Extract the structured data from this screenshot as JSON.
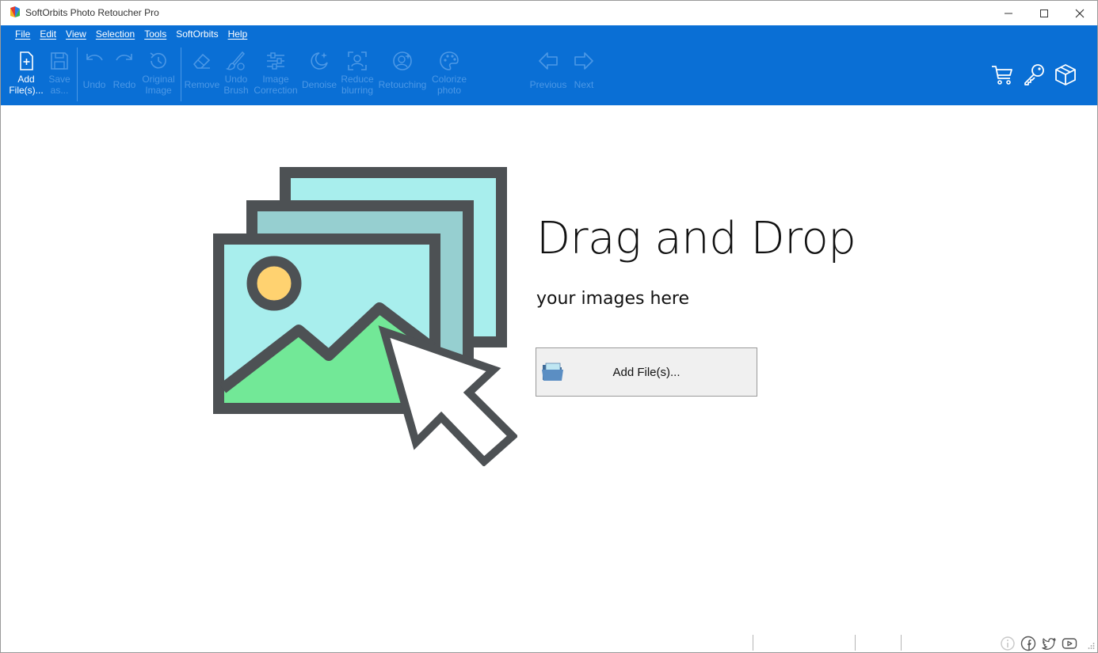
{
  "window": {
    "title": "SoftOrbits Photo Retoucher Pro",
    "controls": [
      "minimize",
      "maximize",
      "close"
    ]
  },
  "menu": [
    {
      "label": "File"
    },
    {
      "label": "Edit"
    },
    {
      "label": "View"
    },
    {
      "label": "Selection"
    },
    {
      "label": "Tools"
    },
    {
      "label": "SoftOrbits"
    },
    {
      "label": "Help"
    }
  ],
  "toolbar": {
    "add_files": "Add\nFile(s)...",
    "save_as": "Save\nas...",
    "undo": "Undo",
    "redo": "Redo",
    "original_image": "Original\nImage",
    "remove": "Remove",
    "undo_brush": "Undo\nBrush",
    "image_correction": "Image\nCorrection",
    "denoise": "Denoise",
    "reduce_blurring": "Reduce\nblurring",
    "retouching": "Retouching",
    "colorize_photo": "Colorize\nphoto",
    "previous": "Previous",
    "next": "Next"
  },
  "right_icons": [
    "cart-icon",
    "key-icon",
    "box-icon"
  ],
  "main": {
    "headline": "Drag and Drop",
    "subline": "your images here",
    "add_button_label": "Add File(s)..."
  },
  "status_icons": [
    "info-icon",
    "facebook-icon",
    "twitter-icon",
    "youtube-icon"
  ],
  "colors": {
    "ribbon": "#0a6fd5",
    "disabled_label": "#4c98e6",
    "frame_dark": "#4d5154",
    "photo_back": "#a8eeed",
    "photo_mid": "#96cfd0",
    "sun": "#ffd270",
    "mountain": "#72e897"
  }
}
